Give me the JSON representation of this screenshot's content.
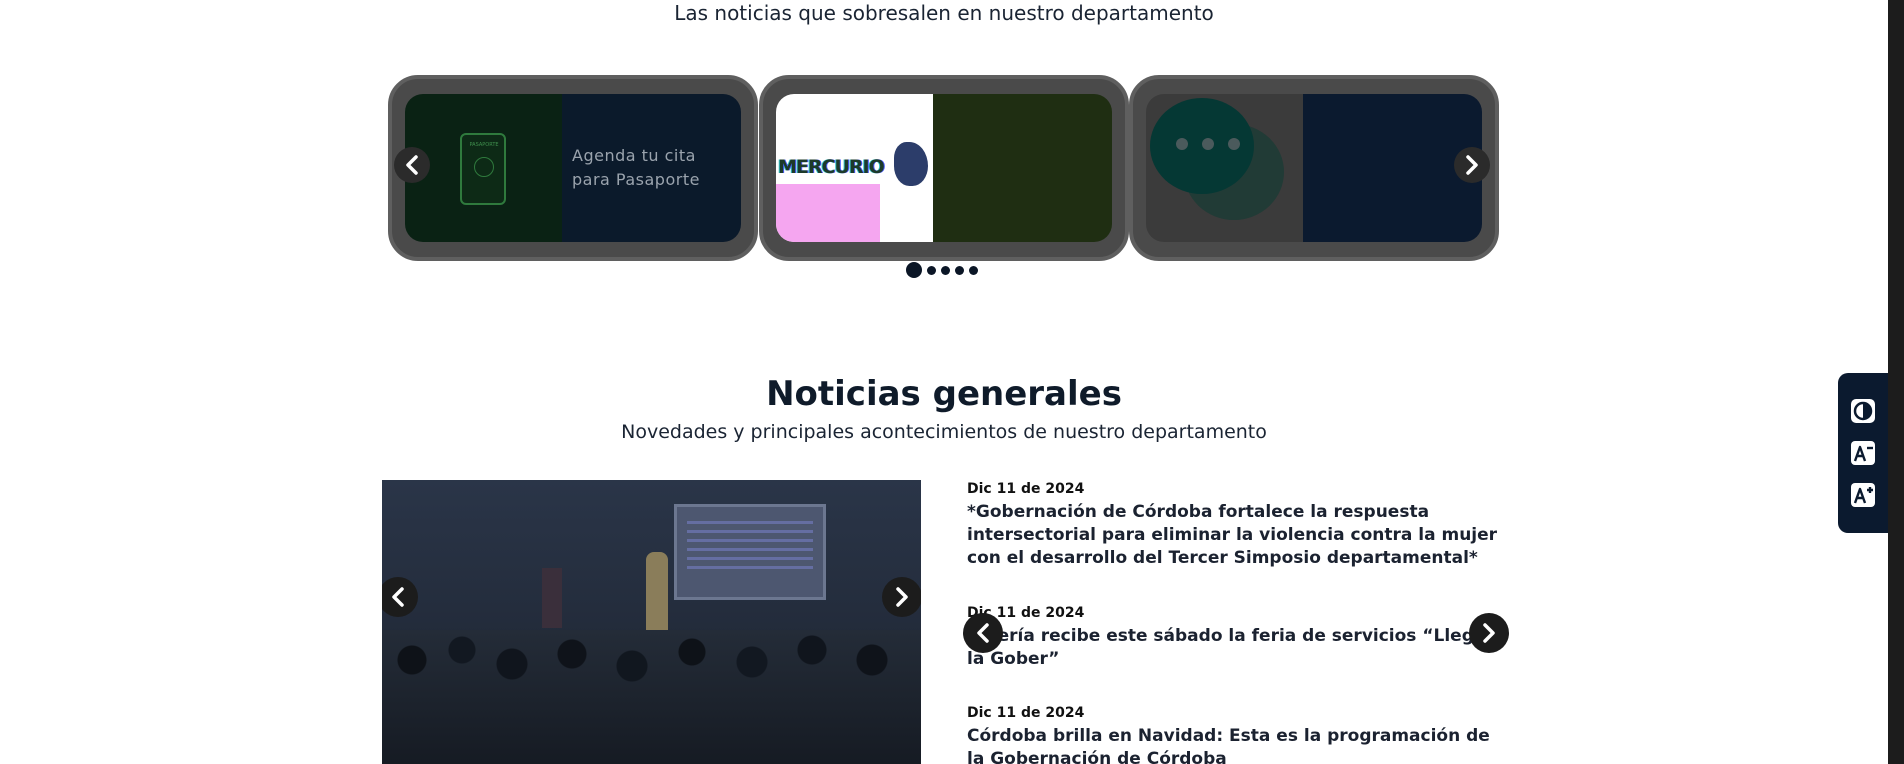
{
  "featured": {
    "subtitle": "Las noticias que sobresalen en nuestro departamento",
    "cards": [
      {
        "text_line1": "Agenda tu cita",
        "text_line2": "para Pasaporte",
        "icon": "passport-icon"
      },
      {
        "logo_text": "MERCURIO",
        "icon": "mercurio-logo"
      },
      {
        "icon": "chat-bubbles-icon"
      }
    ],
    "prev_label": "‹",
    "next_label": "›",
    "page_count": 5,
    "active_page": 1
  },
  "news": {
    "title": "Noticias generales",
    "subtitle": "Novedades y principales acontecimientos de nuestro departamento",
    "prev_label": "‹",
    "next_label": "›",
    "items": [
      {
        "date": "Dic 11 de 2024",
        "headline": "*Gobernación de Córdoba fortalece la respuesta intersectorial para eliminar la violencia contra la mujer con el desarrollo del Tercer Simposio departamental*"
      },
      {
        "date": "Dic 11 de 2024",
        "headline": "Lotería recibe este sábado la feria de servicios “Llegó la Gober”"
      },
      {
        "date": "Dic 11 de 2024",
        "headline": "Córdoba brilla en Navidad: Esta es la programación de la Gobernación de Córdoba"
      }
    ]
  },
  "accessibility": {
    "buttons": [
      "contrast-icon",
      "decrease-text-icon",
      "increase-text-icon"
    ]
  }
}
